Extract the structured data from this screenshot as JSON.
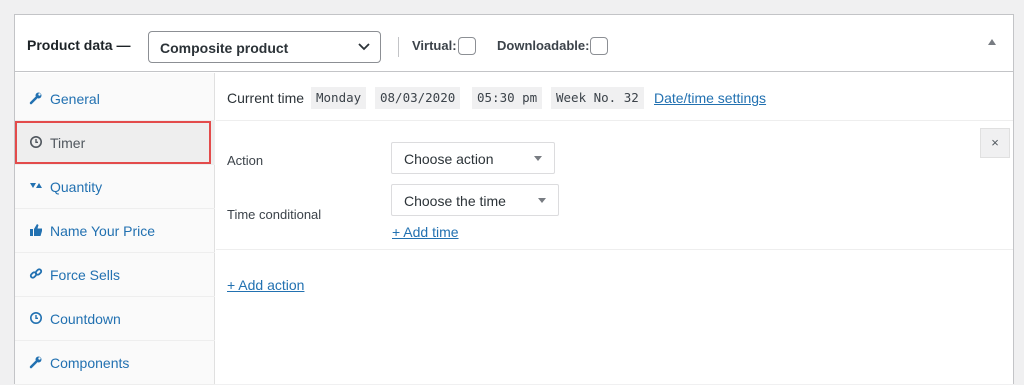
{
  "header": {
    "title": "Product data —",
    "product_type": "Composite product",
    "virtual_label": "Virtual:",
    "downloadable_label": "Downloadable:"
  },
  "sidebar": {
    "items": [
      {
        "label": "General",
        "icon": "wrench-icon"
      },
      {
        "label": "Timer",
        "icon": "clock-icon"
      },
      {
        "label": "Quantity",
        "icon": "arrows-icon"
      },
      {
        "label": "Name Your Price",
        "icon": "thumbs-up-icon"
      },
      {
        "label": "Force Sells",
        "icon": "link-icon"
      },
      {
        "label": "Countdown",
        "icon": "clock-icon"
      },
      {
        "label": "Components",
        "icon": "wrench-icon"
      }
    ]
  },
  "timebar": {
    "label": "Current time",
    "day": "Monday",
    "date": "08/03/2020",
    "time": "05:30 pm",
    "week": "Week No. 32",
    "settings_link": "Date/time settings"
  },
  "rule": {
    "action_label": "Action",
    "action_placeholder": "Choose action",
    "time_label": "Time conditional",
    "time_placeholder": "Choose the time",
    "add_time": "+ Add time",
    "close": "×"
  },
  "add_action": "+ Add action",
  "colors": {
    "link": "#2271b1",
    "highlight": "#e34b4b"
  }
}
